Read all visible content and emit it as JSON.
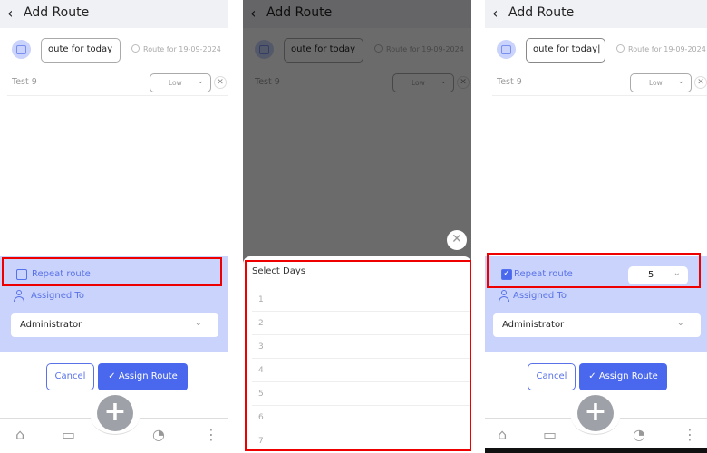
{
  "header": {
    "back_icon": "‹",
    "title": "Add Route"
  },
  "route_name_value": "oute for today",
  "route_for_label": "Route for 19-09-2024",
  "item": {
    "name": "Test 9",
    "priority": "Low"
  },
  "repeat_label": "Repeat route",
  "assigned_label": "Assigned To",
  "assignee": "Administrator",
  "buttons": {
    "cancel": "Cancel",
    "assign": "Assign Route",
    "fab": "+"
  },
  "select_days": {
    "title": "Select Days",
    "options": [
      "1",
      "2",
      "3",
      "4",
      "5",
      "6",
      "7"
    ]
  },
  "repeat_days_value": "5",
  "colors": {
    "accent": "#4a68ee",
    "section_bg": "#c9d3fb",
    "highlight": "#e00000"
  }
}
